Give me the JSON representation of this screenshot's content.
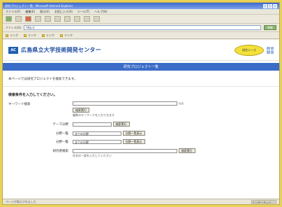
{
  "browser": {
    "title": "研究プロジェクト一覧 - Microsoft Internet Explorer",
    "menu": [
      "ファイル(F)",
      "編集(E)",
      "表示(V)",
      "お気に入り(A)",
      "ツール(T)",
      "ヘルプ(H)"
    ],
    "address_label": "アドレス(D)",
    "address_value": "http://",
    "go_label": "移動",
    "links": [
      "リンク",
      "リンク",
      "リンク",
      "リンク"
    ],
    "status_text": "ページが表示されました",
    "status_zone": "インターネット"
  },
  "header": {
    "logo": "AC",
    "site_title": "広島県立大学技術開発センター",
    "badge": "研究シーズ"
  },
  "section": {
    "title": "研究プロジェクト一覧"
  },
  "intro": "本ページでは研究プロジェクトを検索できます。",
  "instruction": "検索条件を入力してください。",
  "form": {
    "keyword_label": "キーワード検索",
    "keyword_hint": "検索",
    "keyword_button": "検索実行",
    "keyword_note": "複数のキーワードを入力できます",
    "theme_label": "テーマ分野",
    "theme_button": "検索実行",
    "field1_label": "分野一覧",
    "field1_select": "全ての分野",
    "field1_button": "分野一覧表示",
    "field2_label": "分野一覧",
    "field2_select": "全ての分野",
    "field2_button": "分野一覧表示",
    "researcher_label": "研究者検索",
    "researcher_button": "検索実行",
    "researcher_note": "氏名の一部を入力してください"
  }
}
